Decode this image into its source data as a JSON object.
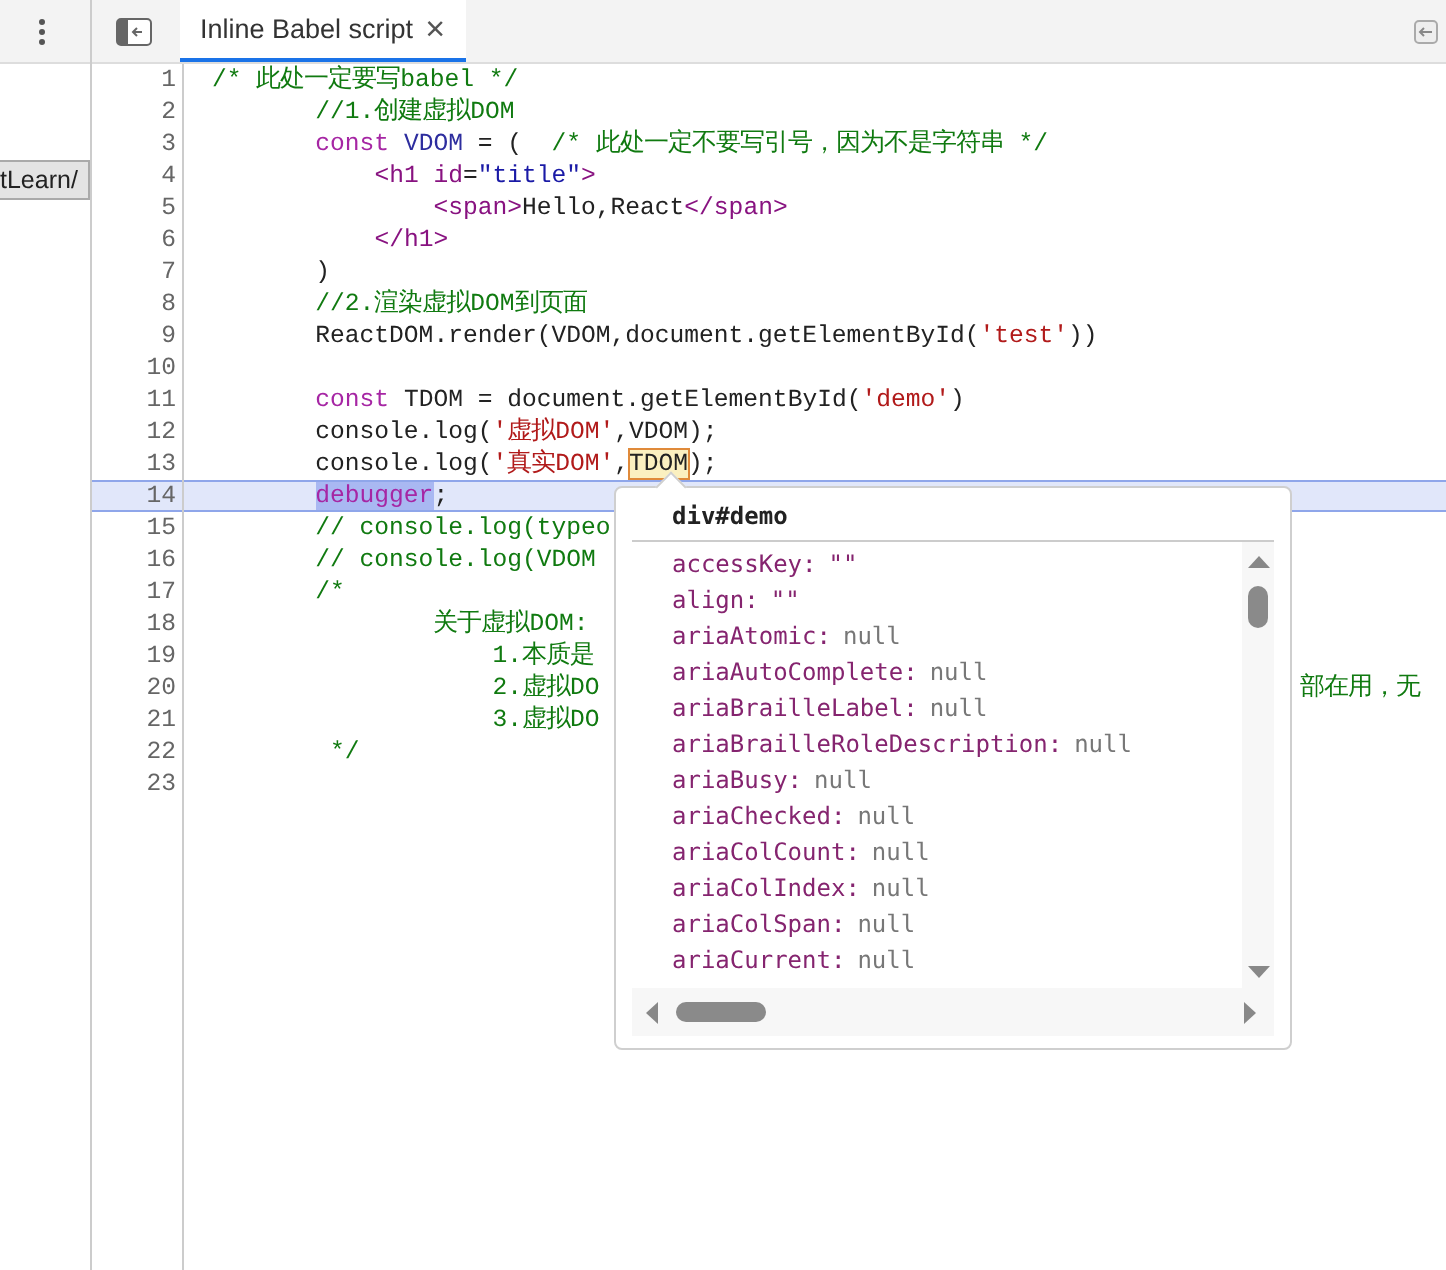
{
  "left_panel": {
    "path_button": "tLearn/"
  },
  "tabs": [
    {
      "label": "Inline Babel script",
      "selected": true,
      "close": "×"
    }
  ],
  "editor": {
    "lines": [
      {
        "number": "1",
        "selected": false,
        "tokens": [
          {
            "kind": "comment",
            "text": "/* 此处一定要写babel */"
          }
        ]
      },
      {
        "number": "2",
        "selected": false,
        "tokens": [
          {
            "kind": "comment",
            "text": "       //1.创建虚拟DOM"
          }
        ]
      },
      {
        "number": "3",
        "selected": false,
        "tokens": [
          {
            "kind": "keyword",
            "text": "       const"
          },
          {
            "kind": "def",
            "text": " VDOM"
          },
          {
            "kind": "plain",
            "text": " = (  "
          },
          {
            "kind": "comment",
            "text": "/* 此处一定不要写引号，因为不是字符串 */"
          }
        ]
      },
      {
        "number": "4",
        "selected": false,
        "tokens": [
          {
            "kind": "tag",
            "text": "           <h1"
          },
          {
            "kind": "attr",
            "text": " id"
          },
          {
            "kind": "plain",
            "text": "="
          },
          {
            "kind": "value",
            "text": "\"title\""
          },
          {
            "kind": "tag",
            "text": ">"
          }
        ]
      },
      {
        "number": "5",
        "selected": false,
        "tokens": [
          {
            "kind": "tag",
            "text": "               <span>"
          },
          {
            "kind": "plain",
            "text": "Hello,React"
          },
          {
            "kind": "tag",
            "text": "</span>"
          }
        ]
      },
      {
        "number": "6",
        "selected": false,
        "tokens": [
          {
            "kind": "tag",
            "text": "           </h1>"
          }
        ]
      },
      {
        "number": "7",
        "selected": false,
        "tokens": [
          {
            "kind": "plain",
            "text": "       )"
          }
        ]
      },
      {
        "number": "8",
        "selected": false,
        "tokens": [
          {
            "kind": "comment",
            "text": "       //2.渲染虚拟DOM到页面"
          }
        ]
      },
      {
        "number": "9",
        "selected": false,
        "tokens": [
          {
            "kind": "plain",
            "text": "       ReactDOM.render(VDOM,document.getElementById("
          },
          {
            "kind": "string",
            "text": "'test'"
          },
          {
            "kind": "plain",
            "text": "))"
          }
        ]
      },
      {
        "number": "10",
        "selected": false
      },
      {
        "number": "11",
        "selected": false,
        "tokens": [
          {
            "kind": "keyword",
            "text": "       const"
          },
          {
            "kind": "plain",
            "text": " TDOM = document.getElementById("
          },
          {
            "kind": "string",
            "text": "'demo'"
          },
          {
            "kind": "plain",
            "text": ")"
          }
        ]
      },
      {
        "number": "12",
        "selected": false,
        "tokens": [
          {
            "kind": "plain",
            "text": "       console.log("
          },
          {
            "kind": "string",
            "text": "'虚拟DOM'"
          },
          {
            "kind": "plain",
            "text": ",VDOM);"
          }
        ]
      },
      {
        "number": "13",
        "selected": false,
        "tokens": [
          {
            "kind": "plain",
            "text": "       console.log("
          },
          {
            "kind": "string",
            "text": "'真实DOM'"
          },
          {
            "kind": "plain",
            "text": ","
          },
          {
            "kind": "hovered",
            "text": "TDOM"
          },
          {
            "kind": "plain",
            "text": ");"
          }
        ]
      },
      {
        "number": "14",
        "selected": true,
        "tokens": [
          {
            "kind": "paused",
            "text": "       debugger"
          },
          {
            "kind": "plain",
            "text": ";"
          }
        ]
      },
      {
        "number": "15",
        "selected": false,
        "tokens": [
          {
            "kind": "comment",
            "text": "       // console.log(typeo"
          }
        ]
      },
      {
        "number": "16",
        "selected": false,
        "tokens": [
          {
            "kind": "comment",
            "text": "       // console.log(VDOM"
          }
        ]
      },
      {
        "number": "17",
        "selected": false,
        "tokens": [
          {
            "kind": "comment",
            "text": "       /*"
          }
        ]
      },
      {
        "number": "18",
        "selected": false,
        "tokens": [
          {
            "kind": "comment",
            "text": "               关于虚拟DOM:"
          }
        ]
      },
      {
        "number": "19",
        "selected": false,
        "tokens": [
          {
            "kind": "comment",
            "text": "                   1.本质是"
          }
        ]
      },
      {
        "number": "20",
        "selected": false,
        "tokens": [
          {
            "kind": "comment",
            "text": "                   2.虚拟DO"
          }
        ],
        "tail": "部在用，无"
      },
      {
        "number": "21",
        "selected": false,
        "tokens": [
          {
            "kind": "comment",
            "text": "                   3.虚拟DO"
          }
        ]
      },
      {
        "number": "22",
        "selected": false,
        "tokens": [
          {
            "kind": "comment",
            "text": "        */"
          }
        ]
      },
      {
        "number": "23",
        "selected": false
      }
    ]
  },
  "popover": {
    "title": "div#demo",
    "properties": [
      {
        "name": "accessKey:",
        "value": "\"\"",
        "kind": "string"
      },
      {
        "name": "align:",
        "value": "\"\"",
        "kind": "string"
      },
      {
        "name": "ariaAtomic:",
        "value": "null",
        "kind": "null"
      },
      {
        "name": "ariaAutoComplete:",
        "value": "null",
        "kind": "null"
      },
      {
        "name": "ariaBrailleLabel:",
        "value": "null",
        "kind": "null"
      },
      {
        "name": "ariaBrailleRoleDescription:",
        "value": "null",
        "kind": "null"
      },
      {
        "name": "ariaBusy:",
        "value": "null",
        "kind": "null"
      },
      {
        "name": "ariaChecked:",
        "value": "null",
        "kind": "null"
      },
      {
        "name": "ariaColCount:",
        "value": "null",
        "kind": "null"
      },
      {
        "name": "ariaColIndex:",
        "value": "null",
        "kind": "null"
      },
      {
        "name": "ariaColSpan:",
        "value": "null",
        "kind": "null"
      },
      {
        "name": "ariaCurrent:",
        "value": "null",
        "kind": "null"
      }
    ]
  }
}
